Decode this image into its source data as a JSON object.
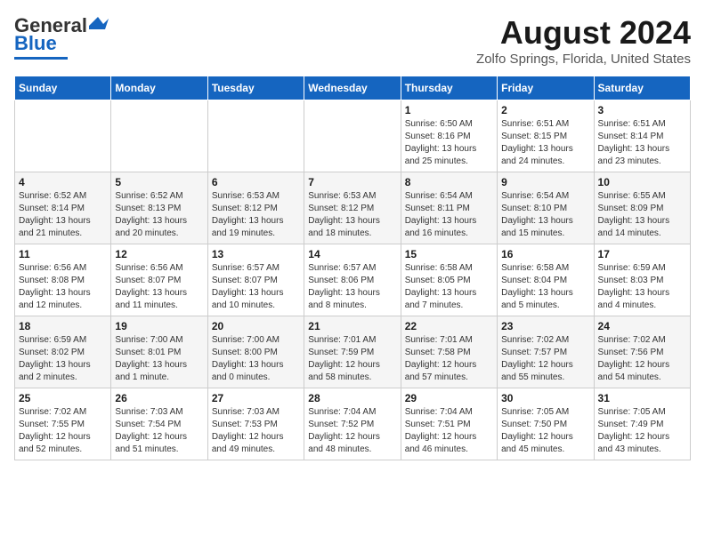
{
  "header": {
    "logo_line1": "General",
    "logo_line2": "Blue",
    "main_title": "August 2024",
    "subtitle": "Zolfo Springs, Florida, United States"
  },
  "calendar": {
    "weekdays": [
      "Sunday",
      "Monday",
      "Tuesday",
      "Wednesday",
      "Thursday",
      "Friday",
      "Saturday"
    ],
    "weeks": [
      [
        {
          "day": "",
          "info": ""
        },
        {
          "day": "",
          "info": ""
        },
        {
          "day": "",
          "info": ""
        },
        {
          "day": "",
          "info": ""
        },
        {
          "day": "1",
          "info": "Sunrise: 6:50 AM\nSunset: 8:16 PM\nDaylight: 13 hours\nand 25 minutes."
        },
        {
          "day": "2",
          "info": "Sunrise: 6:51 AM\nSunset: 8:15 PM\nDaylight: 13 hours\nand 24 minutes."
        },
        {
          "day": "3",
          "info": "Sunrise: 6:51 AM\nSunset: 8:14 PM\nDaylight: 13 hours\nand 23 minutes."
        }
      ],
      [
        {
          "day": "4",
          "info": "Sunrise: 6:52 AM\nSunset: 8:14 PM\nDaylight: 13 hours\nand 21 minutes."
        },
        {
          "day": "5",
          "info": "Sunrise: 6:52 AM\nSunset: 8:13 PM\nDaylight: 13 hours\nand 20 minutes."
        },
        {
          "day": "6",
          "info": "Sunrise: 6:53 AM\nSunset: 8:12 PM\nDaylight: 13 hours\nand 19 minutes."
        },
        {
          "day": "7",
          "info": "Sunrise: 6:53 AM\nSunset: 8:12 PM\nDaylight: 13 hours\nand 18 minutes."
        },
        {
          "day": "8",
          "info": "Sunrise: 6:54 AM\nSunset: 8:11 PM\nDaylight: 13 hours\nand 16 minutes."
        },
        {
          "day": "9",
          "info": "Sunrise: 6:54 AM\nSunset: 8:10 PM\nDaylight: 13 hours\nand 15 minutes."
        },
        {
          "day": "10",
          "info": "Sunrise: 6:55 AM\nSunset: 8:09 PM\nDaylight: 13 hours\nand 14 minutes."
        }
      ],
      [
        {
          "day": "11",
          "info": "Sunrise: 6:56 AM\nSunset: 8:08 PM\nDaylight: 13 hours\nand 12 minutes."
        },
        {
          "day": "12",
          "info": "Sunrise: 6:56 AM\nSunset: 8:07 PM\nDaylight: 13 hours\nand 11 minutes."
        },
        {
          "day": "13",
          "info": "Sunrise: 6:57 AM\nSunset: 8:07 PM\nDaylight: 13 hours\nand 10 minutes."
        },
        {
          "day": "14",
          "info": "Sunrise: 6:57 AM\nSunset: 8:06 PM\nDaylight: 13 hours\nand 8 minutes."
        },
        {
          "day": "15",
          "info": "Sunrise: 6:58 AM\nSunset: 8:05 PM\nDaylight: 13 hours\nand 7 minutes."
        },
        {
          "day": "16",
          "info": "Sunrise: 6:58 AM\nSunset: 8:04 PM\nDaylight: 13 hours\nand 5 minutes."
        },
        {
          "day": "17",
          "info": "Sunrise: 6:59 AM\nSunset: 8:03 PM\nDaylight: 13 hours\nand 4 minutes."
        }
      ],
      [
        {
          "day": "18",
          "info": "Sunrise: 6:59 AM\nSunset: 8:02 PM\nDaylight: 13 hours\nand 2 minutes."
        },
        {
          "day": "19",
          "info": "Sunrise: 7:00 AM\nSunset: 8:01 PM\nDaylight: 13 hours\nand 1 minute."
        },
        {
          "day": "20",
          "info": "Sunrise: 7:00 AM\nSunset: 8:00 PM\nDaylight: 13 hours\nand 0 minutes."
        },
        {
          "day": "21",
          "info": "Sunrise: 7:01 AM\nSunset: 7:59 PM\nDaylight: 12 hours\nand 58 minutes."
        },
        {
          "day": "22",
          "info": "Sunrise: 7:01 AM\nSunset: 7:58 PM\nDaylight: 12 hours\nand 57 minutes."
        },
        {
          "day": "23",
          "info": "Sunrise: 7:02 AM\nSunset: 7:57 PM\nDaylight: 12 hours\nand 55 minutes."
        },
        {
          "day": "24",
          "info": "Sunrise: 7:02 AM\nSunset: 7:56 PM\nDaylight: 12 hours\nand 54 minutes."
        }
      ],
      [
        {
          "day": "25",
          "info": "Sunrise: 7:02 AM\nSunset: 7:55 PM\nDaylight: 12 hours\nand 52 minutes."
        },
        {
          "day": "26",
          "info": "Sunrise: 7:03 AM\nSunset: 7:54 PM\nDaylight: 12 hours\nand 51 minutes."
        },
        {
          "day": "27",
          "info": "Sunrise: 7:03 AM\nSunset: 7:53 PM\nDaylight: 12 hours\nand 49 minutes."
        },
        {
          "day": "28",
          "info": "Sunrise: 7:04 AM\nSunset: 7:52 PM\nDaylight: 12 hours\nand 48 minutes."
        },
        {
          "day": "29",
          "info": "Sunrise: 7:04 AM\nSunset: 7:51 PM\nDaylight: 12 hours\nand 46 minutes."
        },
        {
          "day": "30",
          "info": "Sunrise: 7:05 AM\nSunset: 7:50 PM\nDaylight: 12 hours\nand 45 minutes."
        },
        {
          "day": "31",
          "info": "Sunrise: 7:05 AM\nSunset: 7:49 PM\nDaylight: 12 hours\nand 43 minutes."
        }
      ]
    ]
  }
}
